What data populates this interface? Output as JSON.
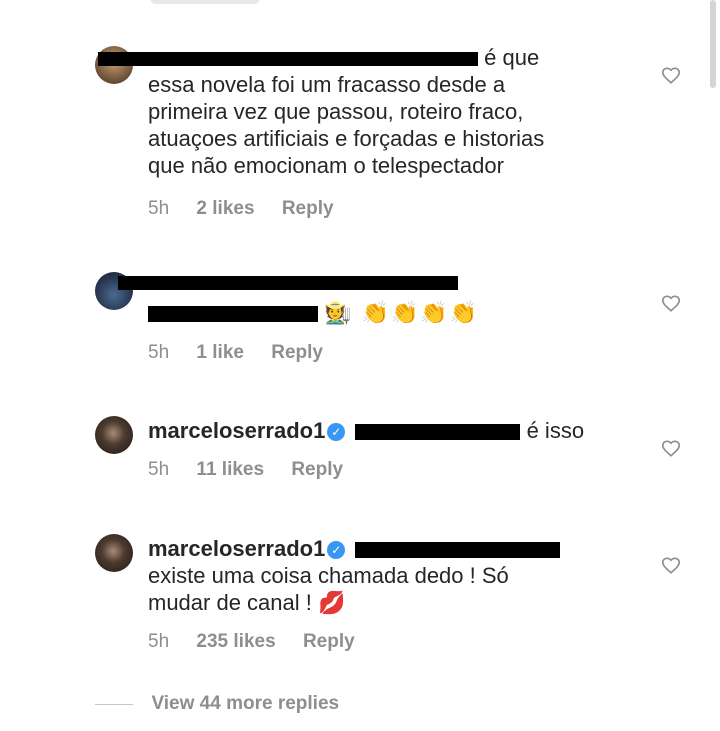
{
  "comments": [
    {
      "username": "",
      "text_suffix": "é que",
      "text_lines": [
        "essa novela foi um fracasso desde a",
        "primeira vez que passou, roteiro fraco,",
        "atuaçoes artificiais e forçadas e historias",
        "que não emocionam o telespectador"
      ],
      "time": "5h",
      "likes": "2 likes",
      "reply": "Reply"
    },
    {
      "username": "",
      "emoji": "🧑‍🌾 👏👏👏👏",
      "time": "5h",
      "likes": "1 like",
      "reply": "Reply"
    },
    {
      "username": "marceloserrado1",
      "text_suffix": "é isso",
      "time": "5h",
      "likes": "11 likes",
      "reply": "Reply"
    },
    {
      "username": "marceloserrado1",
      "text_lines": [
        "existe uma coisa chamada dedo ! Só",
        "mudar de canal ! 💋"
      ],
      "time": "5h",
      "likes": "235 likes",
      "reply": "Reply"
    }
  ],
  "view_more": "View 44 more replies",
  "icons": {
    "verified": "verified-badge-icon",
    "heart": "heart-outline-icon"
  },
  "colors": {
    "text": "#262626",
    "meta": "#8e8e8e",
    "verified": "#3897f0",
    "mention": "#003569"
  }
}
